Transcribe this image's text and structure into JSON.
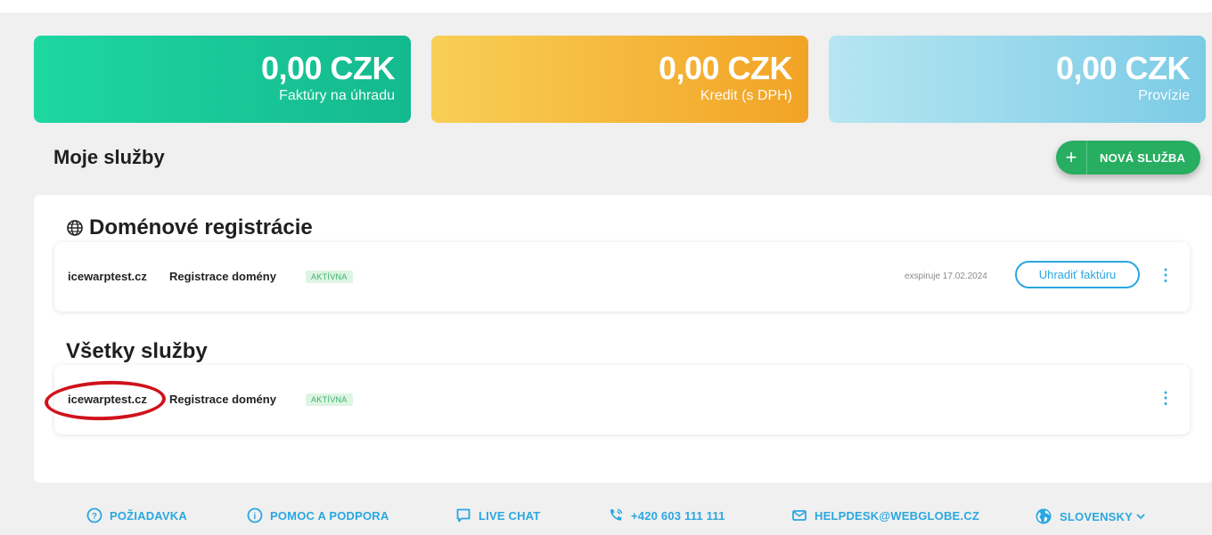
{
  "cards": [
    {
      "amount": "0,00 CZK",
      "label": "Faktúry na úhradu"
    },
    {
      "amount": "0,00 CZK",
      "label": "Kredit (s DPH)"
    },
    {
      "amount": "0,00 CZK",
      "label": "Provízie"
    }
  ],
  "services": {
    "title": "Moje služby",
    "new_button": "NOVÁ SLUŽBA",
    "new_button_icon": "+"
  },
  "domain_section": {
    "title": "Doménové registrácie",
    "icon": "globe-icon",
    "row": {
      "domain": "icewarptest.cz",
      "type": "Registrace domény",
      "status": "AKTÍVNA",
      "expiry": "exspiruje 17.02.2024",
      "pay_button": "Uhradiť faktúru",
      "menu_icon": "⋮"
    }
  },
  "all_section": {
    "title": "Všetky služby",
    "row": {
      "domain": "icewarptest.cz",
      "type": "Registrace domény",
      "status": "AKTÍVNA",
      "menu_icon": "⋮"
    }
  },
  "footer": {
    "request": "POŽIADAVKA",
    "help": "POMOC A PODPORA",
    "chat": "LIVE CHAT",
    "phone": "+420 603 111 111",
    "email": "HELPDESK@WEBGLOBE.CZ",
    "language": "SLOVENSKY"
  },
  "colors": {
    "green": "#27ae60",
    "blue": "#2aa7e0",
    "highlight": "#d0121b"
  }
}
